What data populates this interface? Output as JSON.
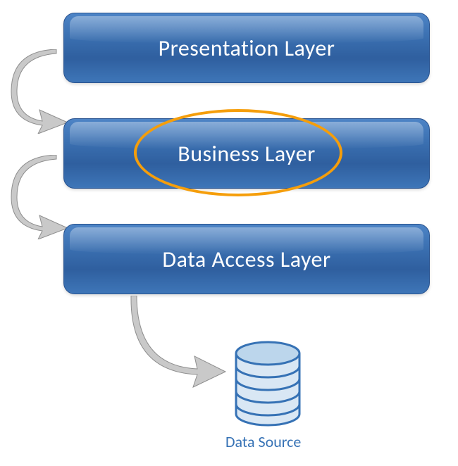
{
  "layers": [
    {
      "label": "Presentation Layer"
    },
    {
      "label": "Business Layer"
    },
    {
      "label": "Data Access Layer"
    }
  ],
  "data_source": {
    "label": "Data Source"
  },
  "highlight": {
    "target_index": 1
  },
  "colors": {
    "box_gradient_top": "#4d84c6",
    "box_gradient_bottom": "#3e76b8",
    "box_border": "#2a5490",
    "highlight_border": "#f59e0b",
    "arrow": "#c0c0c0",
    "arrow_stroke": "#8a8a8a",
    "cylinder_stroke": "#3672b5",
    "cylinder_fill": "#bcd6ec",
    "label_text": "#ffffff",
    "ds_text": "#3672b5"
  }
}
